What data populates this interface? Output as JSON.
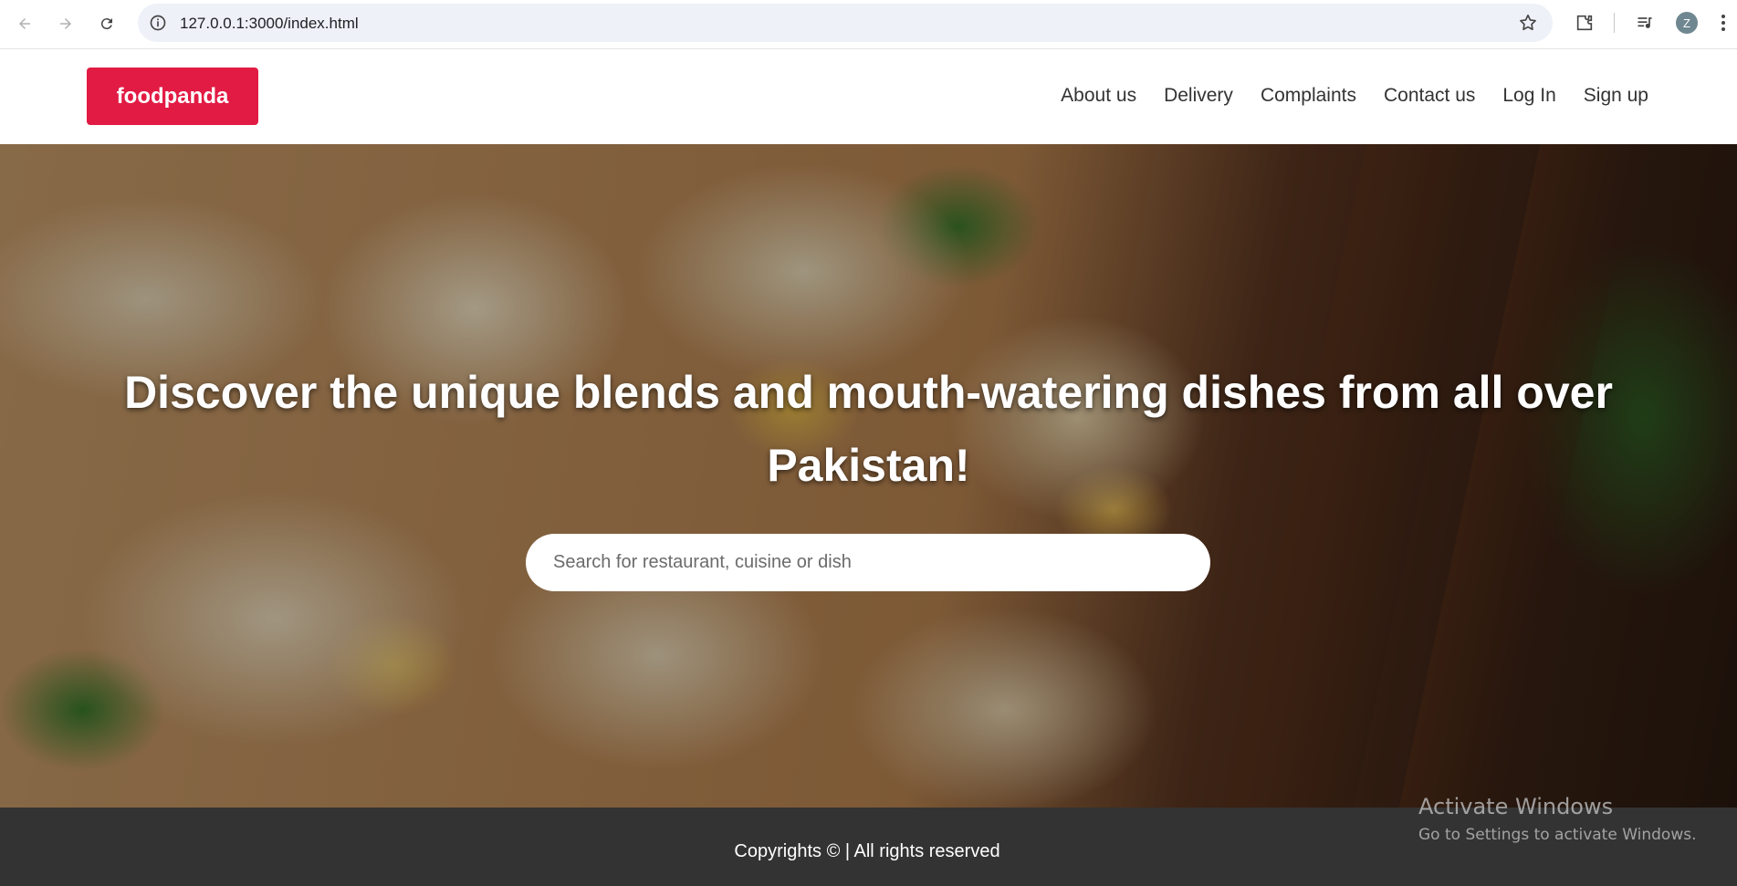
{
  "browser": {
    "url": "127.0.0.1:3000/index.html",
    "avatar_letter": "Z",
    "icons": [
      "back-icon",
      "forward-icon",
      "reload-icon",
      "site-info-icon",
      "star-icon",
      "extensions-icon",
      "media-icon",
      "menu-icon"
    ]
  },
  "header": {
    "logo": "foodpanda",
    "brand_color": "#e21b44",
    "menu": [
      {
        "label": "About us"
      },
      {
        "label": "Delivery"
      },
      {
        "label": "Complaints"
      },
      {
        "label": "Contact us"
      },
      {
        "label": "Log In"
      },
      {
        "label": "Sign up"
      }
    ]
  },
  "hero": {
    "title": "Discover the unique blends and mouth-watering dishes from all over Pakistan!",
    "search_placeholder": "Search for restaurant, cuisine or dish"
  },
  "footer": {
    "text": "Copyrights © | All rights reserved"
  },
  "watermark": {
    "title": "Activate Windows",
    "subtitle": "Go to Settings to activate Windows."
  }
}
